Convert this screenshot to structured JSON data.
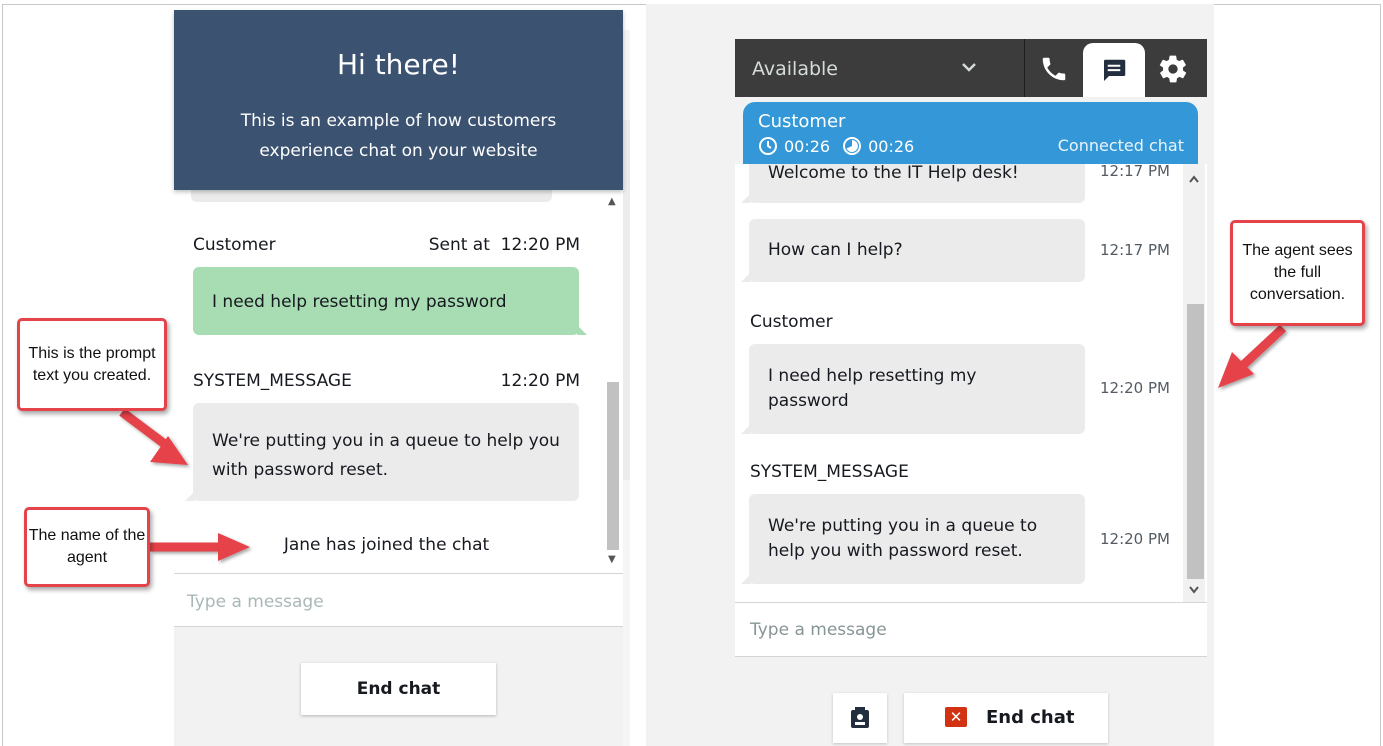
{
  "customer_widget": {
    "header_title": "Hi there!",
    "header_subtitle": "This is an example of how customers experience chat on your website",
    "messages": [
      {
        "sender": "Customer",
        "time": "Sent at  12:20 PM",
        "text": "I need help resetting my password"
      },
      {
        "sender": "SYSTEM_MESSAGE",
        "time": "12:20 PM",
        "text": "We're putting you in a queue to help you with password reset."
      }
    ],
    "event_text": "Jane has joined the chat",
    "input_placeholder": "Type a message",
    "end_chat_label": "End chat"
  },
  "agent_ccp": {
    "status": "Available",
    "contact_name": "Customer",
    "timer_total": "00:26",
    "timer_state": "00:26",
    "contact_state": "Connected chat",
    "messages": [
      {
        "sender": "",
        "text": "Welcome to the IT Help desk!",
        "time": "12:17 PM"
      },
      {
        "sender": "",
        "text": "How can I help?",
        "time": "12:17 PM"
      },
      {
        "sender": "Customer",
        "text": "I need help resetting my password",
        "time": "12:20 PM"
      },
      {
        "sender": "SYSTEM_MESSAGE",
        "text": "We're putting you in a queue to help you with password reset.",
        "time": "12:20 PM"
      }
    ],
    "input_placeholder": "Type a message",
    "end_chat_label": "End chat",
    "accent_color": "#3498d8",
    "topbar_color": "#3c3c3c",
    "icons": [
      "chevron-down-icon",
      "phone-icon",
      "chat-icon",
      "gear-icon",
      "clock-icon",
      "contact-card-icon",
      "end-chat-x-icon"
    ]
  },
  "callouts": {
    "prompt_text": "This is the prompt text you created.",
    "agent_name": "The name of the agent",
    "agent_sees": "The agent sees the full conversation."
  }
}
